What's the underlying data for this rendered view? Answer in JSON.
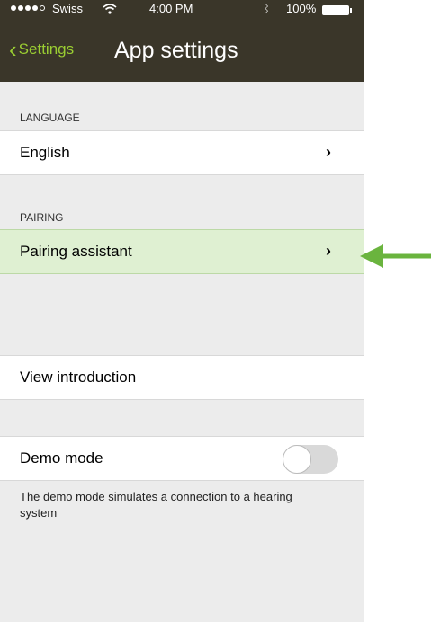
{
  "status_bar": {
    "carrier": "Swiss",
    "time": "4:00 PM",
    "battery": "100%"
  },
  "nav": {
    "back_label": "Settings",
    "title": "App settings"
  },
  "sections": {
    "language_header": "LANGUAGE",
    "language_value": "English",
    "pairing_header": "PAIRING",
    "pairing_assistant": "Pairing assistant",
    "view_introduction": "View introduction",
    "demo_mode": "Demo mode",
    "demo_mode_enabled": false,
    "demo_note": "The demo mode simulates a connection to a hearing system"
  },
  "icons": {
    "back": "chevron-left-icon",
    "disclosure": "chevron-right-icon",
    "annotation": "arrow-left-icon"
  },
  "colors": {
    "header_bg": "#3a3629",
    "accent": "#9acd32",
    "highlight": "#dff0d2",
    "annotation_arrow": "#6ab43e"
  }
}
